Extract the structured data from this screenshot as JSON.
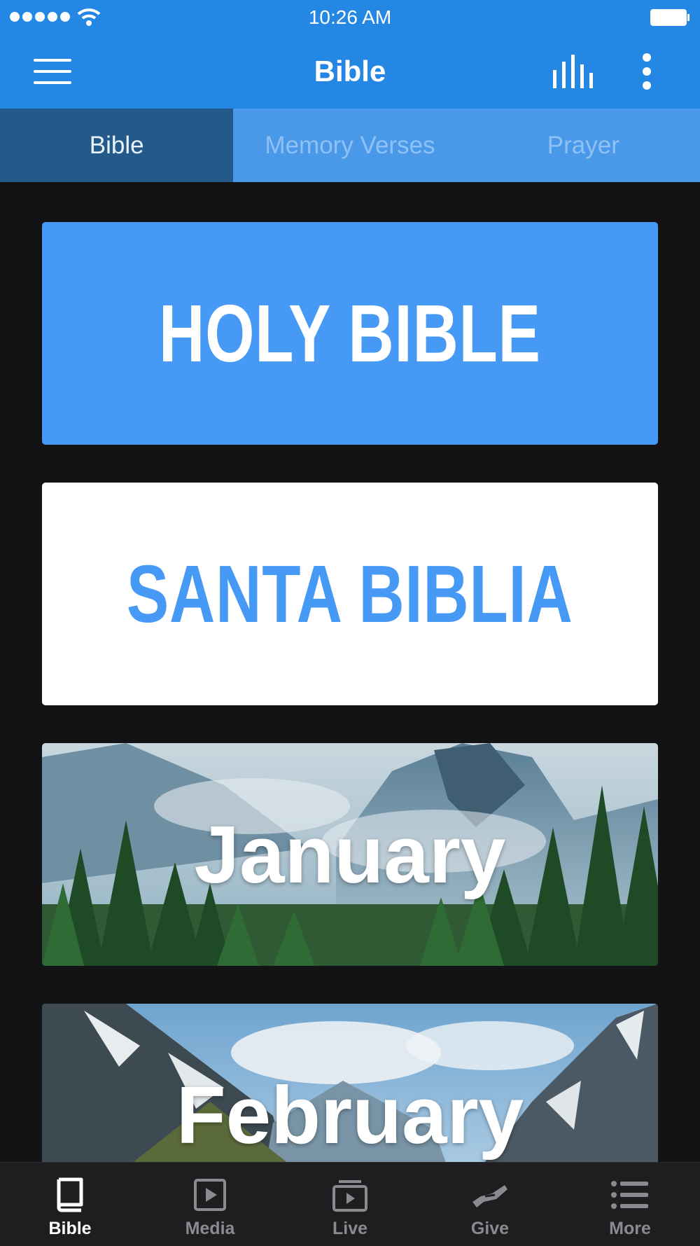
{
  "status_bar": {
    "time": "10:26 AM",
    "signal_icon": "signal-dots-icon",
    "wifi_icon": "wifi-icon",
    "battery_icon": "battery-icon"
  },
  "header": {
    "title": "Bible",
    "menu_icon": "hamburger-menu-icon",
    "audio_icon": "audio-levels-icon",
    "more_icon": "vertical-ellipsis-icon"
  },
  "tabs": [
    {
      "label": "Bible",
      "active": true
    },
    {
      "label": "Memory Verses",
      "active": false
    },
    {
      "label": "Prayer",
      "active": false
    }
  ],
  "cards": [
    {
      "label": "HOLY BIBLE",
      "background": "#4799f6",
      "text_color": "#ffffff"
    },
    {
      "label": "SANTA BIBLIA",
      "background": "#ffffff",
      "text_color": "#4799f6"
    },
    {
      "label": "January",
      "background_image": "forest-mountain-valley"
    },
    {
      "label": "February",
      "background_image": "mountain-cabin-lake"
    }
  ],
  "tab_bar": [
    {
      "label": "Bible",
      "icon": "book-icon",
      "active": true
    },
    {
      "label": "Media",
      "icon": "play-square-icon",
      "active": false
    },
    {
      "label": "Live",
      "icon": "live-stack-icon",
      "active": false
    },
    {
      "label": "Give",
      "icon": "giving-hand-icon",
      "active": false
    },
    {
      "label": "More",
      "icon": "list-icon",
      "active": false
    }
  ],
  "colors": {
    "primary": "#2587e4",
    "tab_strip": "#4a98e8",
    "tab_active": "#245a8a",
    "background": "#131315",
    "tab_bar": "#1e1e20",
    "accent_blue": "#4799f6"
  }
}
